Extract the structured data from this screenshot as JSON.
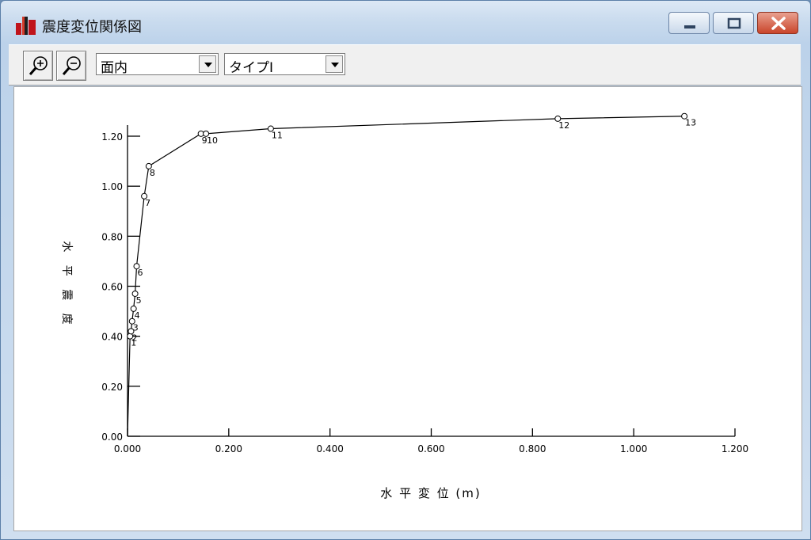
{
  "window": {
    "title": "震度変位関係図",
    "icon": "bar-chart-icon",
    "controls": {
      "minimize": "minimize-icon",
      "maximize": "maximize-icon",
      "close": "close-icon"
    }
  },
  "toolbar": {
    "zoom_in_icon": "zoom-in-icon",
    "zoom_out_icon": "zoom-out-icon",
    "direction_select": {
      "selected": "面内"
    },
    "type_select": {
      "selected": "タイプⅠ"
    }
  },
  "chart_data": {
    "type": "line",
    "xlabel": "水 平 変 位 (m)",
    "ylabel": "水 平 震 度",
    "xlim": [
      0.0,
      1.2
    ],
    "ylim": [
      0.0,
      1.3
    ],
    "x_ticks": [
      "0.000",
      "0.200",
      "0.400",
      "0.600",
      "0.800",
      "1.000",
      "1.200"
    ],
    "y_ticks": [
      "0.00",
      "0.20",
      "0.40",
      "0.60",
      "0.80",
      "1.00",
      "1.20"
    ],
    "grid": false,
    "marker": "circle",
    "points": [
      {
        "label": "1",
        "x": 0.005,
        "y": 0.4
      },
      {
        "label": "2",
        "x": 0.007,
        "y": 0.42
      },
      {
        "label": "3",
        "x": 0.009,
        "y": 0.46
      },
      {
        "label": "4",
        "x": 0.012,
        "y": 0.51
      },
      {
        "label": "5",
        "x": 0.015,
        "y": 0.57
      },
      {
        "label": "6",
        "x": 0.018,
        "y": 0.68
      },
      {
        "label": "7",
        "x": 0.033,
        "y": 0.96
      },
      {
        "label": "8",
        "x": 0.042,
        "y": 1.08
      },
      {
        "label": "9",
        "x": 0.145,
        "y": 1.21
      },
      {
        "label": "10",
        "x": 0.155,
        "y": 1.21
      },
      {
        "label": "11",
        "x": 0.283,
        "y": 1.23
      },
      {
        "label": "12",
        "x": 0.85,
        "y": 1.27
      },
      {
        "label": "13",
        "x": 1.1,
        "y": 1.28
      }
    ]
  }
}
